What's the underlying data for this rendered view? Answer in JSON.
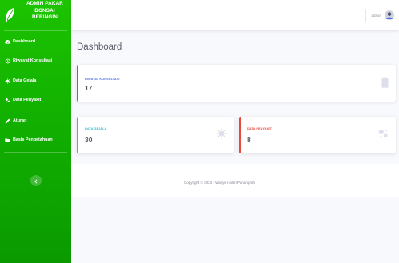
{
  "brand": {
    "line1": "ADMIN PAKAR",
    "line2": "BONSAI",
    "line3": "BERINGIN",
    "logo": "leaf-icon"
  },
  "sidebar": {
    "items": [
      {
        "label": "Dashboard",
        "icon": "tachometer-icon"
      },
      {
        "label": "Riwayat Konsultasi",
        "icon": "history-icon"
      },
      {
        "label": "Data Gejala",
        "icon": "virus-icon"
      },
      {
        "label": "Data Penyakit",
        "icon": "bacteria-icon"
      },
      {
        "label": "Aturan",
        "icon": "pen-icon"
      },
      {
        "label": "Basis Pengetahuan",
        "icon": "folder-icon"
      }
    ]
  },
  "topbar": {
    "username": "admin"
  },
  "page": {
    "title": "Dashboard"
  },
  "cards": [
    {
      "label": "RIWAYAT KONSULTASI",
      "value": "17",
      "icon": "clipboard-icon",
      "accent": "#4e73df"
    },
    {
      "label": "DATA GEJALA",
      "value": "30",
      "icon": "virus-icon",
      "accent": "#36b9cc"
    },
    {
      "label": "DATA PENYAKIT",
      "value": "8",
      "icon": "bacteria-icon",
      "accent": "#e74a3b"
    }
  ],
  "footer": {
    "text": "Copyright © 2024 - Wahyu Halim Panangrah"
  },
  "colors": {
    "sidebar": "#12b000",
    "background": "#f8f9fc",
    "text_muted": "#858796",
    "text_dark": "#5a5c69"
  }
}
